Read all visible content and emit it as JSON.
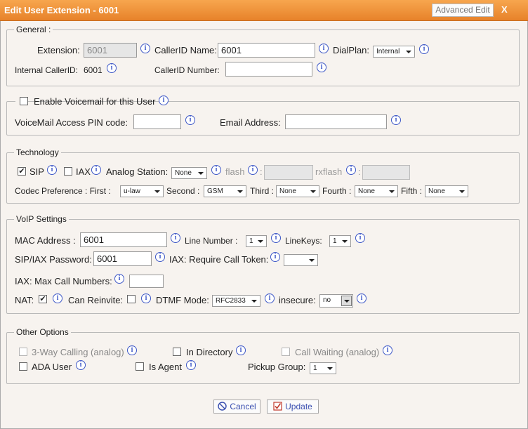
{
  "window": {
    "title": "Edit User Extension - 6001",
    "advanced_edit": "Advanced Edit",
    "close": "X"
  },
  "general": {
    "legend": "General :",
    "extension_label": "Extension:",
    "extension_value": "6001",
    "callerid_name_label": "CallerID Name:",
    "callerid_name_value": "6001",
    "dialplan_label": "DialPlan:",
    "dialplan_value": "Internal",
    "internal_callerid_label": "Internal CallerID:",
    "internal_callerid_value": "6001",
    "callerid_number_label": "CallerID Number:",
    "callerid_number_value": ""
  },
  "voicemail": {
    "legend": "Enable Voicemail for this User",
    "enabled": false,
    "pin_label": "VoiceMail Access PIN code:",
    "pin_value": "",
    "email_label": "Email Address:",
    "email_value": ""
  },
  "technology": {
    "legend": "Technology",
    "sip_label": "SIP",
    "sip_checked": true,
    "iax_label": "IAX",
    "iax_checked": false,
    "analog_label": "Analog Station:",
    "analog_value": "None",
    "flash_label": "flash",
    "rxflash_label": "rxflash",
    "codec_label": "Codec Preference : First :",
    "first_value": "u-law",
    "second_label": "Second :",
    "second_value": "GSM",
    "third_label": "Third :",
    "third_value": "None",
    "fourth_label": "Fourth :",
    "fourth_value": "None",
    "fifth_label": "Fifth :",
    "fifth_value": "None"
  },
  "voip": {
    "legend": "VoIP Settings",
    "mac_label": "MAC Address :",
    "mac_value": "6001",
    "line_number_label": "Line Number :",
    "line_number_value": "1",
    "linekeys_label": "LineKeys:",
    "linekeys_value": "1",
    "password_label": "SIP/IAX Password:",
    "password_value": "6001",
    "iax_token_label": "IAX: Require Call Token:",
    "iax_token_value": "",
    "iax_max_label": "IAX: Max Call Numbers:",
    "iax_max_value": "",
    "nat_label": "NAT:",
    "nat_checked": true,
    "reinvite_label": "Can Reinvite:",
    "reinvite_checked": false,
    "dtmf_label": "DTMF Mode:",
    "dtmf_value": "RFC2833",
    "insecure_label": "insecure:",
    "insecure_value": "no"
  },
  "other": {
    "legend": "Other Options",
    "three_way_label": "3-Way Calling (analog)",
    "in_directory_label": "In Directory",
    "call_waiting_label": "Call Waiting (analog)",
    "ada_label": "ADA User",
    "is_agent_label": "Is Agent",
    "pickup_label": "Pickup Group:",
    "pickup_value": "1"
  },
  "actions": {
    "cancel": "Cancel",
    "update": "Update"
  },
  "info_glyph": "i",
  "colors": {
    "title_bar": "#e98a32",
    "info_icon": "#3e58c7",
    "background": "#f7f3ef"
  }
}
